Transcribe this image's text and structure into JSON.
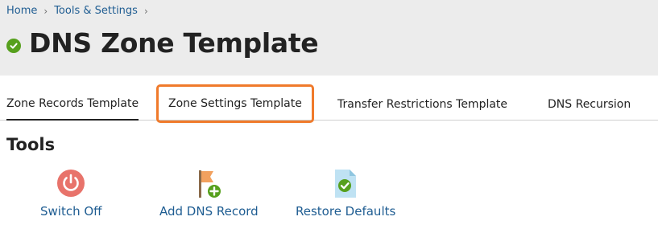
{
  "breadcrumb": {
    "items": [
      "Home",
      "Tools & Settings"
    ],
    "separator": "›"
  },
  "page": {
    "title": "DNS Zone Template",
    "status_color": "#56a01d"
  },
  "tabs": [
    {
      "label": "Zone Records Template",
      "active": true
    },
    {
      "label": "Zone Settings Template",
      "highlighted": true
    },
    {
      "label": "Transfer Restrictions Template"
    },
    {
      "label": "DNS Recursion"
    }
  ],
  "tools": {
    "heading": "Tools",
    "items": [
      {
        "label": "Switch Off",
        "icon": "power-icon"
      },
      {
        "label": "Add DNS Record",
        "icon": "flag-add-icon"
      },
      {
        "label": "Restore Defaults",
        "icon": "document-check-icon"
      }
    ]
  },
  "colors": {
    "link": "#1f5d92",
    "highlight": "#f07a2b",
    "header_bg": "#ececec"
  }
}
